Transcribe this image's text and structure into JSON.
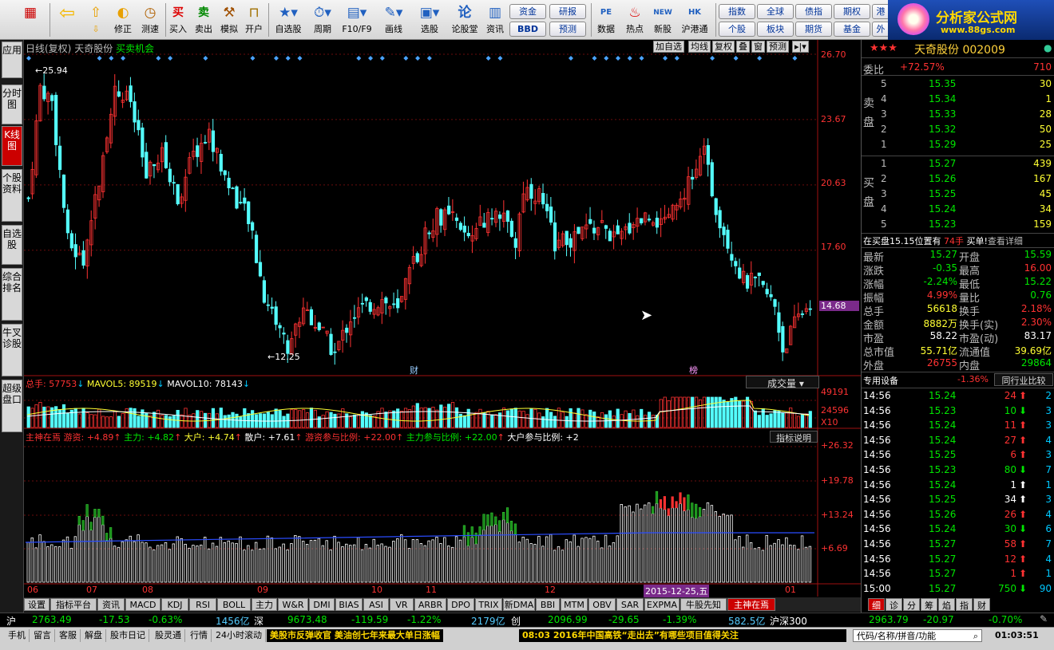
{
  "toolbar": {
    "buttons": [
      {
        "name": "home",
        "label": "",
        "icon": "■"
      },
      {
        "name": "back",
        "label": "",
        "icon": "⇦"
      },
      {
        "name": "up-down",
        "label": "",
        "icon": "⇧"
      },
      {
        "name": "modify",
        "label": "修正",
        "icon": "◐"
      },
      {
        "name": "speed",
        "label": "测速",
        "icon": "◷"
      },
      {
        "name": "buy",
        "label": "买入",
        "icon": "买"
      },
      {
        "name": "sell",
        "label": "卖出",
        "icon": "卖"
      },
      {
        "name": "simulate",
        "label": "模拟",
        "icon": "⚒"
      },
      {
        "name": "open",
        "label": "开户",
        "icon": "🔒"
      },
      {
        "name": "watchlist",
        "label": "自选股",
        "icon": "★"
      },
      {
        "name": "period",
        "label": "周期",
        "icon": "⏱"
      },
      {
        "name": "f10",
        "label": "F10/F9",
        "icon": "▤"
      },
      {
        "name": "draw",
        "label": "画线",
        "icon": "✎"
      },
      {
        "name": "select",
        "label": "选股",
        "icon": "▣"
      },
      {
        "name": "forum",
        "label": "论股堂",
        "icon": "论"
      },
      {
        "name": "info",
        "label": "资讯",
        "icon": "▥"
      },
      {
        "name": "data",
        "label": "数据",
        "icon": "PE"
      },
      {
        "name": "hot",
        "label": "热点",
        "icon": "♨"
      },
      {
        "name": "ipo",
        "label": "新股",
        "icon": "NEW"
      },
      {
        "name": "hk",
        "label": "沪港通",
        "icon": "HK"
      }
    ],
    "small_buttons": [
      "资金",
      "研报",
      "BBD",
      "预测",
      "指数",
      "全球",
      "债指",
      "期权",
      "个股",
      "板块",
      "期货",
      "基金",
      "港",
      "外"
    ]
  },
  "logo": {
    "title": "分析家公式网",
    "url": "www.88gs.com"
  },
  "left_tabs": [
    "应用",
    "分时图",
    "K线图",
    "个股资料",
    "自选股",
    "综合排名",
    "牛叉诊股",
    "超级盘口"
  ],
  "chart": {
    "header": {
      "mode": "日线(复权)",
      "stock": "天奇股份",
      "signal": "买卖机会"
    },
    "buttons": [
      "加自选",
      "均线",
      "复权",
      "叠",
      "窗",
      "预测"
    ],
    "y_labels": [
      "26.70",
      "23.67",
      "20.63",
      "17.60",
      "14.68"
    ],
    "high_label": "25.94",
    "low_label": "12.25",
    "event_labels": [
      "财",
      "榜"
    ],
    "vol_header": {
      "total_label": "总手: 57753",
      "mavol5": "MAVOL5: 89519",
      "mavol10": "MAVOL10: 78143",
      "selector": "成交量"
    },
    "vol_y_labels": [
      "49191",
      "24596",
      "X10"
    ],
    "ind_header": {
      "name": "主神在焉",
      "youzi": "游资: +4.89",
      "zhuli": "主力: +4.82",
      "dahu": "大户: +4.74",
      "sanhu": "散户: +7.61",
      "youzi_ratio": "游资参与比例: +22.00",
      "zhuli_ratio": "主力参与比例: +22.00",
      "dahu_ratio": "大户参与比例: +2",
      "explain": "指标说明"
    },
    "ind_y_labels": [
      "+26.32",
      "+19.78",
      "+13.24",
      "+6.69"
    ],
    "x_labels": [
      "06",
      "07",
      "08",
      "09",
      "10",
      "11",
      "12",
      "01"
    ],
    "date_tag": "2015-12-25,五"
  },
  "bottom_tabs": [
    "设置",
    "指标平台",
    "资讯",
    "MACD",
    "KDJ",
    "RSI",
    "BOLL",
    "主力",
    "W&R",
    "DMI",
    "BIAS",
    "ASI",
    "VR",
    "ARBR",
    "DPO",
    "TRIX",
    "新DMA",
    "BBI",
    "MTM",
    "OBV",
    "SAR",
    "EXPMA",
    "牛股先知",
    "主神在焉"
  ],
  "quote": {
    "stars": "★★★",
    "name": "天奇股份",
    "code": "002009",
    "weibi_label": "委比",
    "weibi": "+72.57%",
    "weicha": "710",
    "sell_label": "卖盘",
    "buy_label": "买盘",
    "asks": [
      {
        "lvl": "5",
        "p": "15.35",
        "v": "30"
      },
      {
        "lvl": "4",
        "p": "15.34",
        "v": "1"
      },
      {
        "lvl": "3",
        "p": "15.33",
        "v": "28"
      },
      {
        "lvl": "2",
        "p": "15.32",
        "v": "50"
      },
      {
        "lvl": "1",
        "p": "15.29",
        "v": "25"
      }
    ],
    "bids": [
      {
        "lvl": "1",
        "p": "15.27",
        "v": "439"
      },
      {
        "lvl": "2",
        "p": "15.26",
        "v": "167"
      },
      {
        "lvl": "3",
        "p": "15.25",
        "v": "45"
      },
      {
        "lvl": "4",
        "p": "15.24",
        "v": "34"
      },
      {
        "lvl": "5",
        "p": "15.23",
        "v": "159"
      }
    ],
    "note": "在买盘15.15位置有",
    "note_num": "74手",
    "note_act": "买单!",
    "note_link": "查看详细",
    "stats": [
      [
        "最新",
        "15.27",
        "开盘",
        "15.59"
      ],
      [
        "涨跌",
        "-0.35",
        "最高",
        "16.00"
      ],
      [
        "涨幅",
        "-2.24%",
        "最低",
        "15.22"
      ],
      [
        "振幅",
        "4.99%",
        "量比",
        "0.76"
      ],
      [
        "总手",
        "56618",
        "换手",
        "2.18%"
      ],
      [
        "金额",
        "8882万",
        "换手(实)",
        "2.30%"
      ],
      [
        "市盈",
        "58.22",
        "市盈(动)",
        "83.17"
      ],
      [
        "总市值",
        "55.71亿",
        "流通值",
        "39.69亿"
      ],
      [
        "外盘",
        "26755",
        "内盘",
        "29864"
      ]
    ],
    "industry": "专用设备",
    "industry_chg": "-1.36%",
    "compare": "同行业比较",
    "ticks": [
      [
        "14:56",
        "15.24",
        "24",
        "up",
        "2"
      ],
      [
        "14:56",
        "15.23",
        "10",
        "dn",
        "3"
      ],
      [
        "14:56",
        "15.24",
        "11",
        "up",
        "3"
      ],
      [
        "14:56",
        "15.24",
        "27",
        "up",
        "4"
      ],
      [
        "14:56",
        "15.25",
        "6",
        "up",
        "3"
      ],
      [
        "14:56",
        "15.23",
        "80",
        "dn",
        "7"
      ],
      [
        "14:56",
        "15.24",
        "1",
        "wup",
        "1"
      ],
      [
        "14:56",
        "15.25",
        "34",
        "wup",
        "3"
      ],
      [
        "14:56",
        "15.26",
        "26",
        "up",
        "4"
      ],
      [
        "14:56",
        "15.24",
        "30",
        "dn",
        "6"
      ],
      [
        "14:56",
        "15.27",
        "58",
        "up",
        "7"
      ],
      [
        "14:56",
        "15.27",
        "12",
        "up",
        "4"
      ],
      [
        "14:56",
        "15.27",
        "1",
        "up",
        "1"
      ],
      [
        "15:00",
        "15.27",
        "750",
        "dn",
        "90"
      ]
    ],
    "tabs": [
      "细",
      "诊",
      "分",
      "筹",
      "焰",
      "指",
      "财"
    ]
  },
  "index_bar": {
    "sh_label": "沪",
    "sh": "2763.49",
    "sh_chg": "-17.53",
    "sh_pct": "-0.63%",
    "sh_amt": "1456亿",
    "sz_label": "深",
    "sz": "9673.48",
    "sz_chg": "-119.59",
    "sz_pct": "-1.22%",
    "sz_amt": "2179亿",
    "cy_label": "创",
    "cy": "2096.99",
    "cy_chg": "-29.65",
    "cy_pct": "-1.39%",
    "cy_amt": "582.5亿",
    "hs_label": "沪深300",
    "hs": "2963.79",
    "hs_chg": "-20.97",
    "hs_pct": "-0.70%"
  },
  "status_bar": {
    "items": [
      "手机",
      "留言",
      "客服",
      "解盘",
      "股市日记",
      "股灵通",
      "行情",
      "24小时滚动"
    ],
    "news1": "美股市反弹收官 美油创七年来最大单日涨幅",
    "news2": "08:03 2016年中国高铁“走出去”有哪些项目值得关注",
    "search_placeholder": "代码/名称/拼音/功能",
    "time": "01:03:51"
  },
  "colors": {
    "up": "#ff3232",
    "down": "#54ffff",
    "bg": "#000000",
    "grid": "#7a1010"
  },
  "chart_data": {
    "type": "candlestick",
    "price_range": [
      12.0,
      26.7
    ],
    "high": 25.94,
    "low": 12.25,
    "last_close": 15.27,
    "volume_range": [
      0,
      49191
    ],
    "indicator_range": [
      0,
      26.32
    ]
  }
}
